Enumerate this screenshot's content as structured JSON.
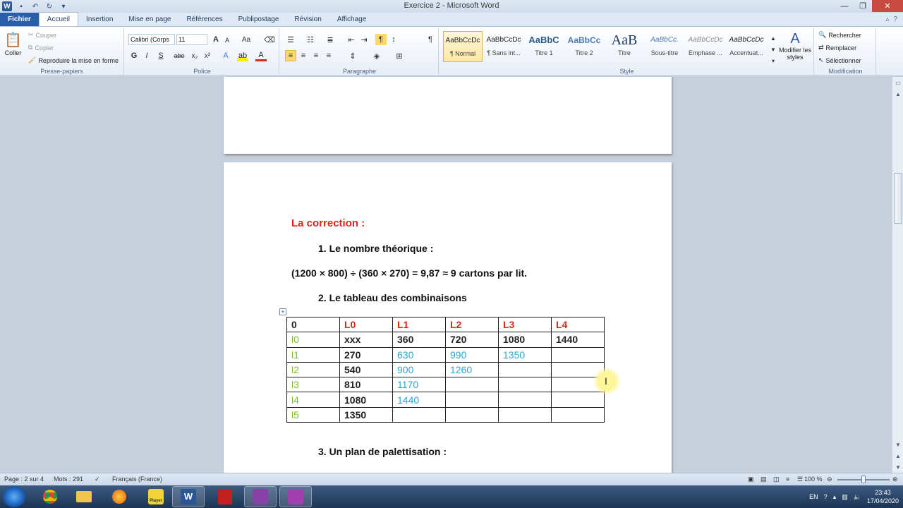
{
  "window": {
    "title": "Exercice 2 - Microsoft Word",
    "app_letter": "W"
  },
  "tabs": [
    {
      "label": "Fichier"
    },
    {
      "label": "Accueil"
    },
    {
      "label": "Insertion"
    },
    {
      "label": "Mise en page"
    },
    {
      "label": "Références"
    },
    {
      "label": "Publipostage"
    },
    {
      "label": "Révision"
    },
    {
      "label": "Affichage"
    }
  ],
  "ribbon": {
    "clipboard": {
      "paste": "Coller",
      "cut": "Couper",
      "copy": "Copier",
      "format_painter": "Reproduire la mise en forme",
      "label": "Presse-papiers"
    },
    "font": {
      "family": "Calibri (Corps",
      "size": "11",
      "label": "Police",
      "bold": "G",
      "italic": "I",
      "underline": "S",
      "strike": "abe",
      "subscript": "x₂",
      "superscript": "x²",
      "case": "Aa",
      "grow": "A",
      "shrink": "A"
    },
    "paragraph": {
      "label": "Paragraphe"
    },
    "styles": {
      "label": "Style",
      "items": [
        {
          "preview": "AaBbCcDc",
          "name": "¶ Normal"
        },
        {
          "preview": "AaBbCcDc",
          "name": "¶ Sans int..."
        },
        {
          "preview": "AaBbC",
          "name": "Titre 1"
        },
        {
          "preview": "AaBbCc",
          "name": "Titre 2"
        },
        {
          "preview": "AaB",
          "name": "Titre"
        },
        {
          "preview": "AaBbCc.",
          "name": "Sous-titre"
        },
        {
          "preview": "AaBbCcDc",
          "name": "Emphase ..."
        },
        {
          "preview": "AaBbCcDc",
          "name": "Accentuat..."
        }
      ],
      "modify": "Modifier les styles"
    },
    "editing": {
      "label": "Modification",
      "find": "Rechercher",
      "replace": "Remplacer",
      "select": "Sélectionner"
    }
  },
  "document": {
    "heading": "La correction :",
    "item1": "1.  Le nombre théorique  :",
    "formula": "(1200 × 800) ÷ (360 × 270) = 9,87 ≈ 9 cartons  par lit.",
    "item2": "2.   Le tableau des combinaisons",
    "item3": "3.  Un plan de palettisation  :",
    "table": {
      "header": [
        "0",
        "L0",
        "L1",
        "L2",
        "L3",
        "L4"
      ],
      "rows": [
        [
          "l0",
          "xxx",
          "360",
          "720",
          "1080",
          "1440"
        ],
        [
          "l1",
          "270",
          "630",
          "990",
          "1350",
          ""
        ],
        [
          "l2",
          "540",
          "900",
          "1260",
          "",
          ""
        ],
        [
          "l3",
          "810",
          "1170",
          "",
          "",
          ""
        ],
        [
          "l4",
          "1080",
          "1440",
          "",
          "",
          ""
        ],
        [
          "l5",
          "1350",
          "",
          "",
          "",
          ""
        ]
      ]
    }
  },
  "statusbar": {
    "page": "Page : 2 sur 4",
    "words": "Mots : 291",
    "language": "Français (France)",
    "zoom": "100 %"
  },
  "taskbar": {
    "player_label": "Player",
    "lang": "EN",
    "time": "23:43",
    "date": "17/04/2020"
  },
  "colors": {
    "heading_red": "#d9261c",
    "row_green": "#7cbf3a",
    "value_blue": "#2aa5d4",
    "file_tab": "#2a5ea8"
  }
}
